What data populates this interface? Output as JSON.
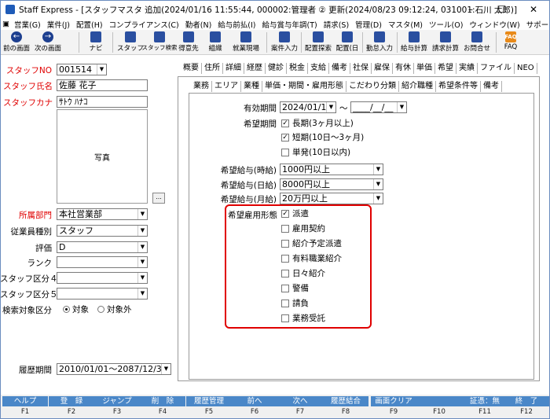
{
  "window": {
    "title": "Staff Express - [スタッフマスタ  追加(2024/01/16 11:55:44, 000002:管理者   ② 更新(2024/08/23 09:12:24, 031001:石川   太郎)]",
    "minimize": "–",
    "maximize": "☐",
    "close": "✕"
  },
  "menu": [
    "営業(G)",
    "業件(J)",
    "配置(H)",
    "コンプライアンス(C)",
    "勤者(N)",
    "給与前払(I)",
    "給与賞与年調(T)",
    "請求(S)",
    "管理(D)",
    "マスタ(M)",
    "ツール(O)",
    "ウィンドウ(W)",
    "サポート(H)"
  ],
  "toolbar": {
    "prev": "前の画面",
    "next": "次の画面",
    "navi": "ナビ",
    "staff": "スタッフ",
    "staff_search": "スタッフ検索",
    "tokuisaki": "得意先",
    "soshiki": "組織",
    "shugyo_genba": "就業現場",
    "yoken_nyuryoku": "案件入力",
    "haichi_tansaku": "配置探索",
    "haichi_date": "配置(日",
    "kintai_nyuryoku": "勤怠入力",
    "kyuyo_keisan": "給与計算",
    "seikyu_keisan": "請求計算",
    "okiniiri": "お問合せ",
    "faq": "FAQ",
    "faq_icon_text": "FAQ"
  },
  "left": {
    "staff_no_label": "スタッフNO",
    "staff_no": "001514",
    "name_label": "スタッフ氏名",
    "name": "佐藤  花子",
    "kana_label": "スタッフカナ",
    "kana": "ｻﾄｳ ﾊﾅｺ",
    "photo_label": "写真",
    "dots": "...",
    "dept_label": "所属部門",
    "dept": "本社営業部",
    "emp_type_label": "従業員種別",
    "emp_type": "スタッフ",
    "rating_label": "評価",
    "rating": "D",
    "rank_label": "ランク",
    "rank": "",
    "class4_label": "スタッフ区分４",
    "class4": "",
    "class5_label": "スタッフ区分５",
    "class5": "",
    "search_target_label": "検索対象区分",
    "search_target_on": "対象",
    "search_target_off": "対象外",
    "history_label": "履歴期間",
    "history": "2010/01/01～2087/12/31"
  },
  "tabs_top": [
    "概要",
    "住所",
    "詳細",
    "経歴",
    "健診",
    "税金",
    "支給",
    "備考",
    "社保",
    "雇保",
    "有休",
    "単価",
    "希望",
    "実績",
    "ファイル",
    "NEO"
  ],
  "tabs_sub": [
    "業務",
    "エリア",
    "業種",
    "単価・期間・雇用形態",
    "こだわり分類",
    "紹介職種",
    "希望条件等",
    "備考"
  ],
  "form": {
    "period_label": "有効期間",
    "period_from": "2024/01/16",
    "tilde": "～",
    "period_to": "____/__/__",
    "hope_period_label": "希望期間",
    "long_term": "長期(3ヶ月以上)",
    "short_term": "短期(10日～3ヶ月)",
    "one_off": "単発(10日以内)",
    "pay_hour_label": "希望給与(時給)",
    "pay_hour": "1000円以上",
    "pay_day_label": "希望給与(日給)",
    "pay_day": "8000円以上",
    "pay_month_label": "希望給与(月給)",
    "pay_month": "20万円以上",
    "emp_form_label": "希望雇用形態",
    "emp_forms": [
      "派遣",
      "雇用契約",
      "紹介予定派遣",
      "有料職業紹介",
      "日々紹介",
      "警備",
      "請負",
      "業務受託"
    ]
  },
  "fkeys": [
    {
      "label": "ヘルプ",
      "key": "F1"
    },
    {
      "label": "登　録",
      "key": "F2"
    },
    {
      "label": "ジャンプ",
      "key": "F3"
    },
    {
      "label": "削　除",
      "key": "F4"
    },
    {
      "label": "履歴管理",
      "key": "F5"
    },
    {
      "label": "前へ",
      "key": "F6"
    },
    {
      "label": "次へ",
      "key": "F7"
    },
    {
      "label": "履歴結合",
      "key": "F8"
    },
    {
      "label": "画面クリア",
      "key": "F9"
    },
    {
      "label": "",
      "key": "F10"
    },
    {
      "label": "証憑：無",
      "key": "F11"
    },
    {
      "label": "終　了",
      "key": "F12"
    }
  ]
}
